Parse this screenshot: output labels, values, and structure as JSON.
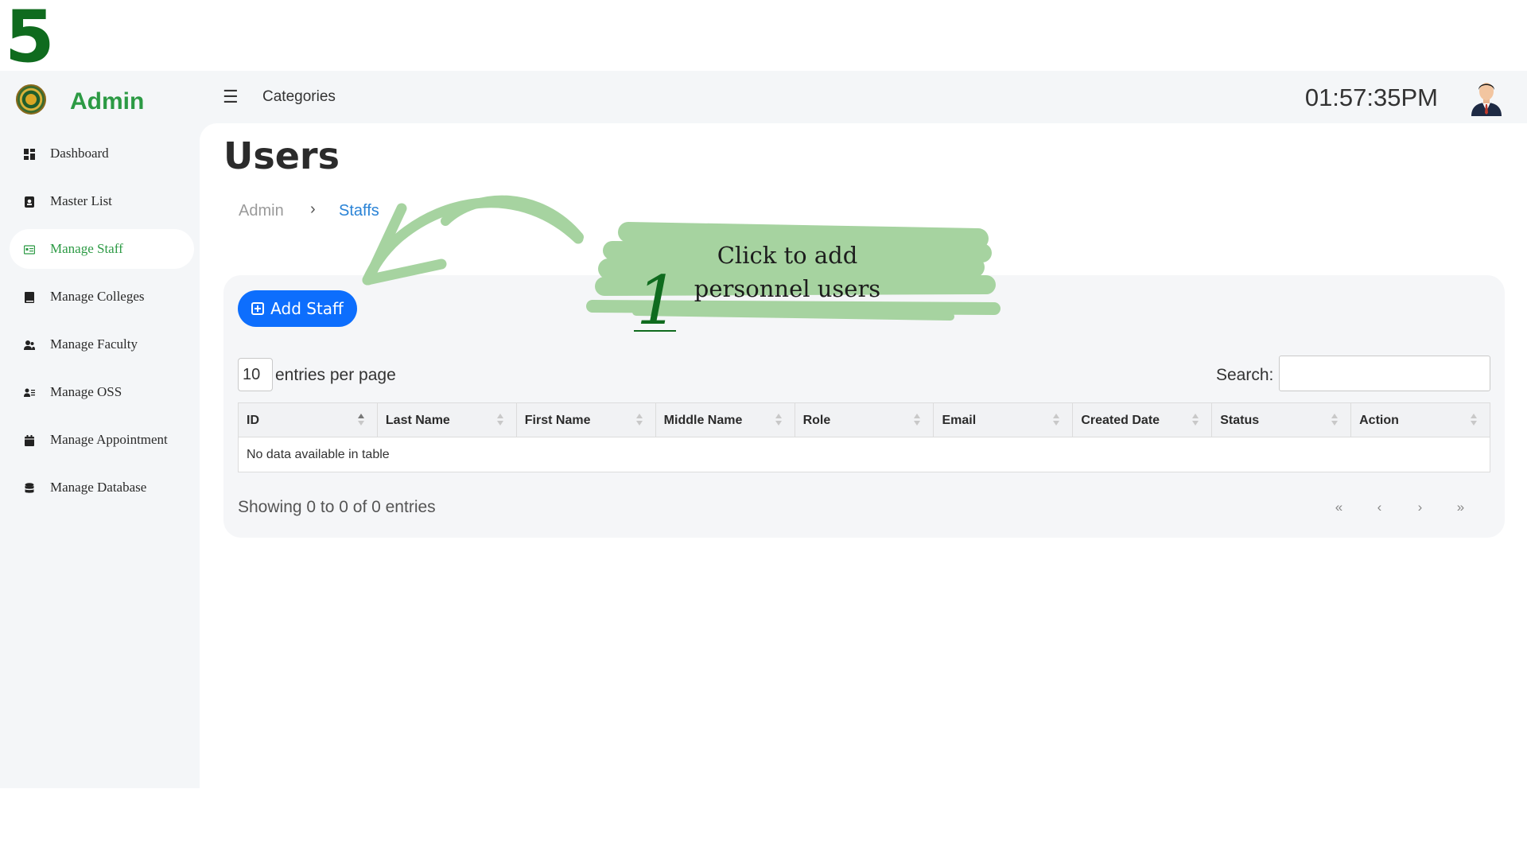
{
  "step": "5",
  "header": {
    "brand": "Admin",
    "menu_icon": "☰",
    "categories_label": "Categories",
    "clock": "01:57:35PM"
  },
  "sidebar": {
    "items": [
      {
        "label": "Dashboard",
        "icon": "dashboard-icon"
      },
      {
        "label": "Master List",
        "icon": "contact-card-icon"
      },
      {
        "label": "Manage Staff",
        "icon": "id-card-icon",
        "active": true
      },
      {
        "label": "Manage Colleges",
        "icon": "book-icon"
      },
      {
        "label": "Manage Faculty",
        "icon": "users-icon"
      },
      {
        "label": "Manage OSS",
        "icon": "user-list-icon"
      },
      {
        "label": "Manage Appointment",
        "icon": "calendar-icon"
      },
      {
        "label": "Manage Database",
        "icon": "database-icon"
      }
    ]
  },
  "main": {
    "title": "Users",
    "breadcrumb": {
      "root": "Admin",
      "separator": "›",
      "current": "Staffs"
    },
    "add_button_label": "Add Staff",
    "per_page_value": "10",
    "per_page_label": "entries per page",
    "search_label": "Search:",
    "table": {
      "columns": [
        "ID",
        "Last Name",
        "First Name",
        "Middle Name",
        "Role",
        "Email",
        "Created Date",
        "Status",
        "Action"
      ],
      "empty_message": "No data available in table"
    },
    "showing": "Showing 0 to 0 of 0 entries",
    "pager": [
      "«",
      "‹",
      "›",
      "»"
    ]
  },
  "annotation": {
    "line1": "Click to add",
    "line2": "personnel users",
    "number": "1"
  },
  "colors": {
    "brand_green": "#2c9a44",
    "primary_blue": "#0d6efd",
    "link_blue": "#2a83d6",
    "highlight_green": "#a6d3a0",
    "step_green": "#0f6b1e"
  }
}
